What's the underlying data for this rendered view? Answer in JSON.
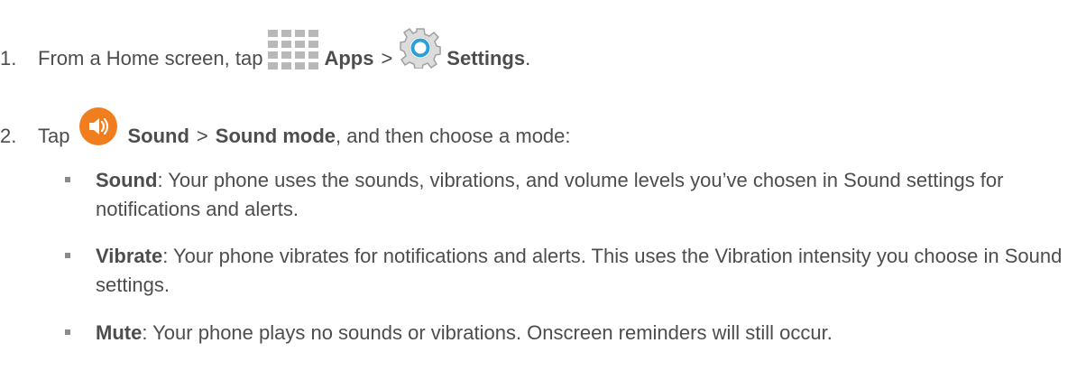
{
  "steps": [
    {
      "number": "1.",
      "text_before": "From a Home screen, tap",
      "apps_icon": "apps-grid-icon",
      "apps_label": "Apps",
      "separator": ">",
      "settings_icon": "gear-icon",
      "settings_label": "Settings",
      "end": "."
    },
    {
      "number": "2.",
      "text_before": "Tap",
      "sound_icon": "speaker-icon",
      "sound_label": "Sound",
      "separator": ">",
      "mode_label": "Sound mode",
      "text_after": ", and then choose a mode:"
    }
  ],
  "modes": [
    {
      "term": "Sound",
      "description": ": Your phone uses the sounds, vibrations, and volume levels you’ve chosen in Sound settings for notifications and alerts."
    },
    {
      "term": "Vibrate",
      "description": ": Your phone vibrates for notifications and alerts. This uses the Vibration intensity you choose in Sound settings."
    },
    {
      "term": "Mute",
      "description": ": Your phone plays no sounds or vibrations. Onscreen reminders will still occur."
    }
  ],
  "colors": {
    "text": "#4d4d4d",
    "sound_icon": "#f07d1e",
    "settings_icon": "#2a9fd8",
    "apps_icon": "#b8b8b8"
  }
}
